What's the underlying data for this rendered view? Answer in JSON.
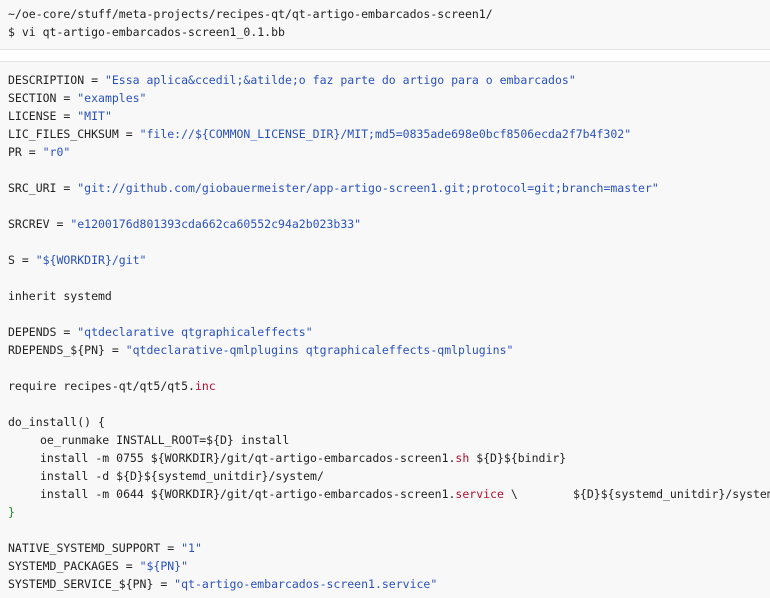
{
  "shell": {
    "path": "~/oe-core/stuff/meta-projects/recipes-qt/qt-artigo-embarcados-screen1/",
    "command": "$ vi qt-artigo-embarcados-screen1_0.1.bb"
  },
  "recipe": {
    "description_key": "DESCRIPTION = ",
    "description_val": "\"Essa aplica&ccedil;&atilde;o faz parte do artigo para o embarcados\"",
    "section_key": "SECTION = ",
    "section_val": "\"examples\"",
    "license_key": "LICENSE = ",
    "license_val": "\"MIT\"",
    "lic_key": "LIC_FILES_CHKSUM = ",
    "lic_val": "\"file://${COMMON_LICENSE_DIR}/MIT;md5=0835ade698e0bcf8506ecda2f7b4f302\"",
    "pr_key": "PR = ",
    "pr_val": "\"r0\"",
    "src_uri_key": "SRC_URI = ",
    "src_uri_val": "\"git://github.com/giobauermeister/app-artigo-screen1.git;protocol=git;branch=master\"",
    "srcrev_key": "SRCREV = ",
    "srcrev_val": "\"e1200176d801393cda662ca60552c94a2b023b33\"",
    "s_key": "S = ",
    "s_val": "\"${WORKDIR}/git\"",
    "inherit": "inherit systemd",
    "depends_key": "DEPENDS = ",
    "depends_val": "\"qtdeclarative qtgraphicaleffects\"",
    "rdepends_key": "RDEPENDS_${PN} = ",
    "rdepends_val": "\"qtdeclarative-qmlplugins qtgraphicaleffects-qmlplugins\"",
    "require_text": "require recipes-qt/qt5/qt5.",
    "require_ext": "inc",
    "do_install_open": "do_install() {",
    "inst1": "oe_runmake INSTALL_ROOT=${D} install",
    "inst2_a": "install -m 0755 ${WORKDIR}/git/qt-artigo-embarcados-screen1.",
    "inst2_ext": "sh",
    "inst2_b": " ${D}${bindir}",
    "inst3": "install -d ${D}${systemd_unitdir}/system/",
    "inst4_a": "install -m 0644 ${WORKDIR}/git/qt-artigo-embarcados-screen1.",
    "inst4_ext": "service",
    "inst4_b": " \\",
    "inst4_tail": "${D}${systemd_unitdir}/system",
    "do_install_close": "}",
    "native_key": "NATIVE_SYSTEMD_SUPPORT = ",
    "native_val": "\"1\"",
    "packages_key": "SYSTEMD_PACKAGES = ",
    "packages_val": "\"${PN}\"",
    "service_key": "SYSTEMD_SERVICE_${PN} = ",
    "service_val": "\"qt-artigo-embarcados-screen1.service\""
  }
}
